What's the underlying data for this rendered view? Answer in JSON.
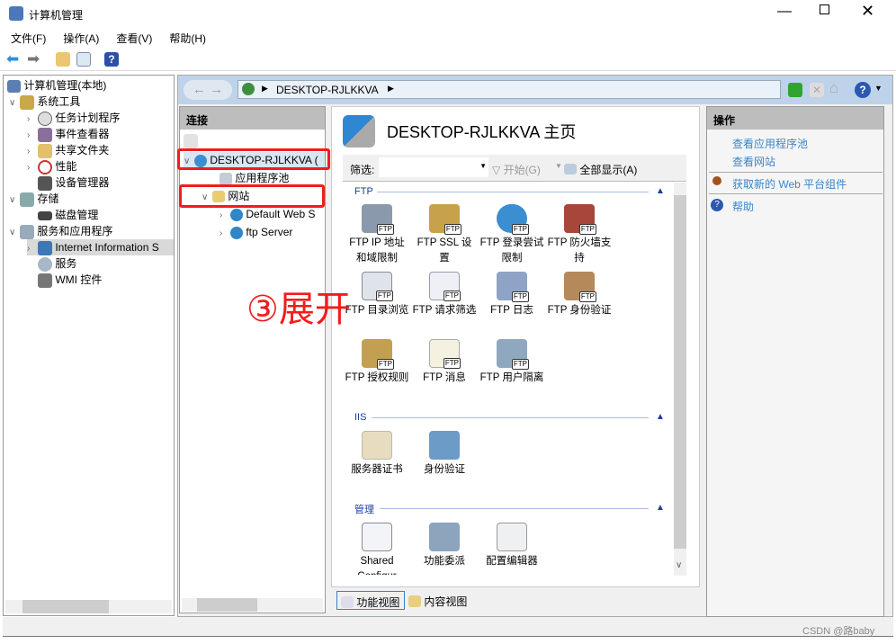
{
  "window": {
    "title": "计算机管理",
    "controls": [
      "minimize",
      "maximize",
      "close"
    ]
  },
  "menu": [
    "文件(F)",
    "操作(A)",
    "查看(V)",
    "帮助(H)"
  ],
  "tree": {
    "root": "计算机管理(本地)",
    "items": [
      {
        "label": "系统工具",
        "level": 1,
        "expanded": true
      },
      {
        "label": "任务计划程序",
        "level": 2
      },
      {
        "label": "事件查看器",
        "level": 2
      },
      {
        "label": "共享文件夹",
        "level": 2
      },
      {
        "label": "性能",
        "level": 2
      },
      {
        "label": "设备管理器",
        "level": 2
      },
      {
        "label": "存储",
        "level": 1,
        "expanded": true
      },
      {
        "label": "磁盘管理",
        "level": 2
      },
      {
        "label": "服务和应用程序",
        "level": 1,
        "expanded": true
      },
      {
        "label": "Internet Information S",
        "level": 2,
        "selected": true
      },
      {
        "label": "服务",
        "level": 2
      },
      {
        "label": "WMI 控件",
        "level": 2
      }
    ]
  },
  "address": {
    "path": "DESKTOP-RJLKKVA"
  },
  "connections": {
    "header": "连接",
    "server": "DESKTOP-RJLKKVA (",
    "app_pools": "应用程序池",
    "sites": "网站",
    "site_items": [
      "Default Web S",
      "ftp Server"
    ]
  },
  "center": {
    "title": "DESKTOP-RJLKKVA 主页",
    "filter_label": "筛选:",
    "filter_value": "",
    "go_label": "开始(G)",
    "show_all_label": "全部显示(A)",
    "groups": [
      {
        "name": "FTP",
        "features": [
          "FTP IP 地址和域限制",
          "FTP SSL 设置",
          "FTP 登录尝试限制",
          "FTP 防火墙支持",
          "FTP 目录浏览",
          "FTP 请求筛选",
          "FTP 日志",
          "FTP 身份验证",
          "FTP 授权规则",
          "FTP 消息",
          "FTP 用户隔离"
        ]
      },
      {
        "name": "IIS",
        "features": [
          "服务器证书",
          "身份验证"
        ]
      },
      {
        "name": "管理",
        "features": [
          "Shared Configur",
          "功能委派",
          "配置编辑器"
        ]
      }
    ],
    "tabs": [
      "功能视图",
      "内容视图"
    ],
    "icon_tag": "FTP"
  },
  "actions": {
    "header": "操作",
    "items": [
      "查看应用程序池",
      "查看网站",
      "获取新的 Web 平台组件",
      "帮助"
    ]
  },
  "annotation": {
    "text": "③展开",
    "color": "#f21c1c"
  },
  "watermark": "CSDN @路baby"
}
